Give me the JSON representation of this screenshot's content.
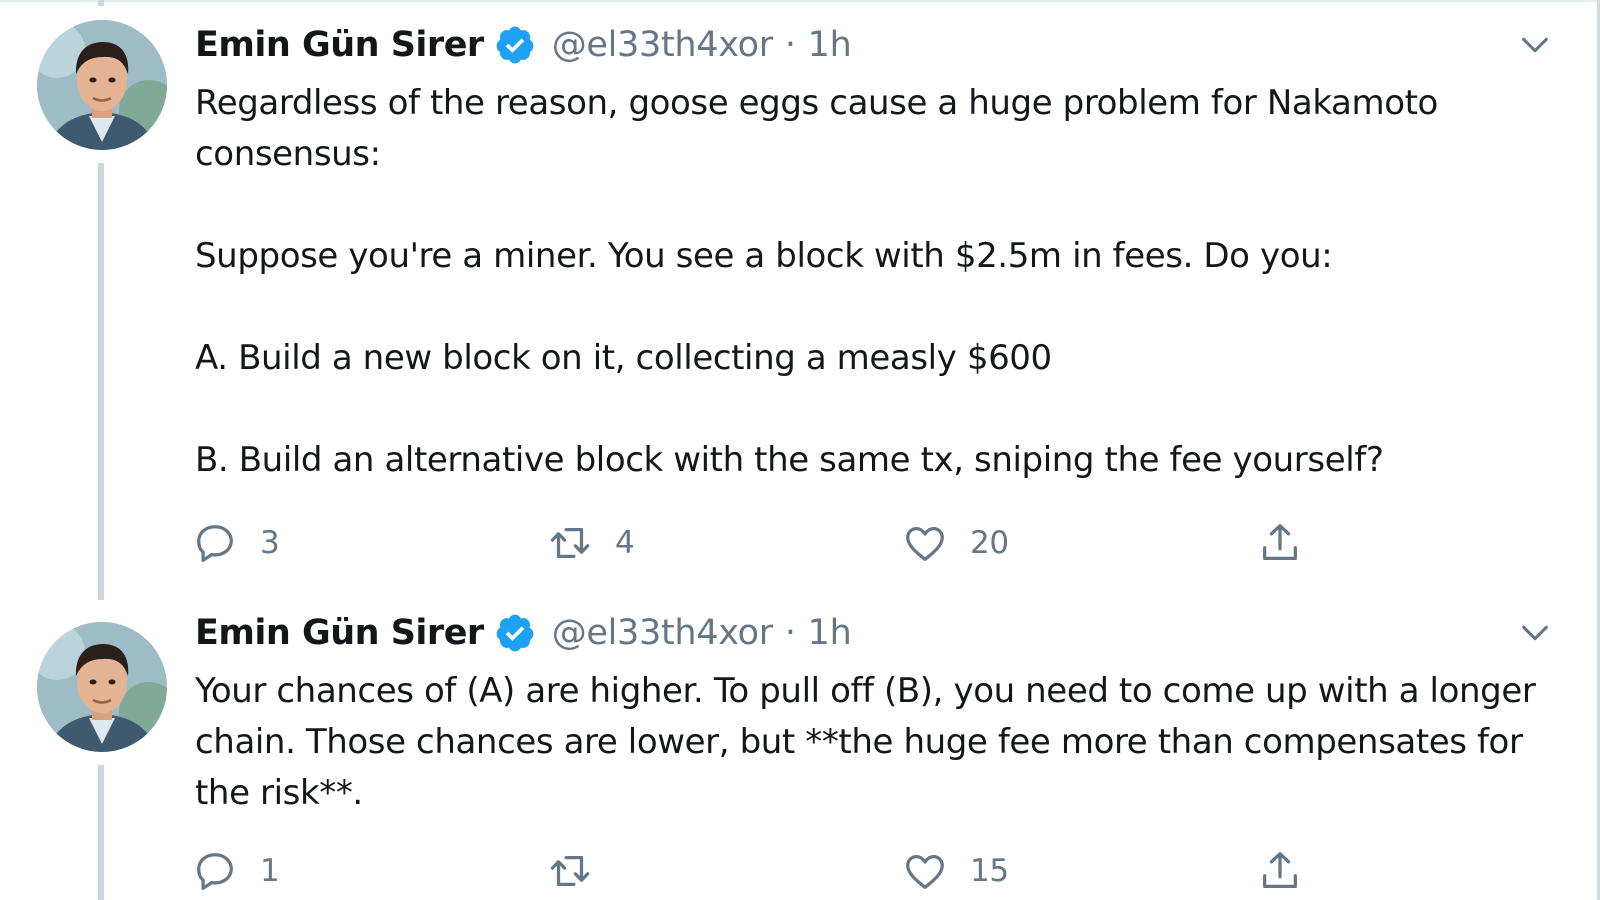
{
  "accent_color": "#1da1f2",
  "tweets": [
    {
      "author": {
        "name": "Emin Gün Sirer",
        "handle": "@el33th4xor",
        "time": "1h",
        "dot": "·",
        "verified": true,
        "avatar_icon": "user-avatar"
      },
      "text_paragraphs": [
        "Regardless of the reason, goose eggs cause a huge problem for Nakamoto consensus:",
        "Suppose you're a miner. You see a block with $2.5m in fees. Do you:",
        "A. Build a new block on it, collecting a measly $600",
        "B. Build an alternative block with the same tx, sniping the fee yourself?"
      ],
      "actions": {
        "reply_count": "3",
        "retweet_count": "4",
        "like_count": "20",
        "share_count": ""
      }
    },
    {
      "author": {
        "name": "Emin Gün Sirer",
        "handle": "@el33th4xor",
        "time": "1h",
        "dot": "·",
        "verified": true,
        "avatar_icon": "user-avatar"
      },
      "text_paragraphs": [
        "Your chances of (A) are higher. To pull off (B), you need to come up with a longer chain. Those chances are lower, but **the huge fee more than compensates for the risk**."
      ],
      "actions": {
        "reply_count": "1",
        "retweet_count": "",
        "like_count": "15",
        "share_count": ""
      }
    }
  ]
}
